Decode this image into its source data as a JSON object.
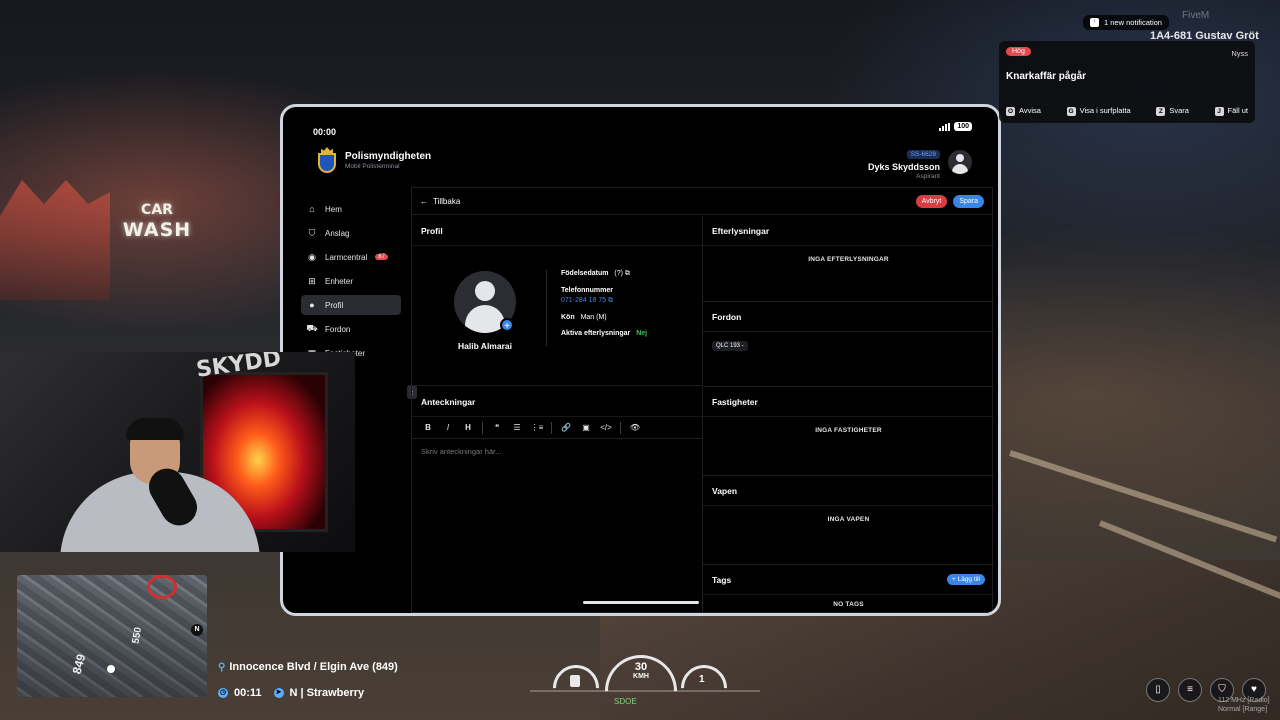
{
  "tablet": {
    "time": "00:00",
    "battery": "100",
    "brand_title": "Polismyndigheten",
    "brand_sub": "Mobil Polisterminal",
    "callsign": "SS-6628",
    "user_name": "Dyks Skyddsson",
    "user_rank": "Aspirant"
  },
  "sidebar": {
    "items": [
      {
        "label": "Hem",
        "icon": "home-icon"
      },
      {
        "label": "Anslag",
        "icon": "bookmark-icon"
      },
      {
        "label": "Larmcentral",
        "icon": "radio-icon",
        "badge": "87"
      },
      {
        "label": "Enheter",
        "icon": "grid-icon"
      },
      {
        "label": "Profil",
        "icon": "user-icon"
      },
      {
        "label": "Fordon",
        "icon": "car-icon"
      },
      {
        "label": "Fastigheter",
        "icon": "building-icon"
      }
    ]
  },
  "topbar": {
    "back_label": "Tillbaka",
    "cancel_label": "Avbryt",
    "save_label": "Spara"
  },
  "profile": {
    "title": "Profil",
    "name": "Halib Almarai",
    "birth_label": "Födelsedatum",
    "birth_value": "(?)",
    "phone_label": "Telefonnummer",
    "phone_value": "071-284 18 75",
    "gender_label": "Kön",
    "gender_value": "Man (M)",
    "warrants_label": "Aktiva efterlysningar",
    "warrants_value": "Nej"
  },
  "notes": {
    "title": "Anteckningar",
    "placeholder": "Skriv anteckningar här...",
    "toolbar": [
      "B",
      "I",
      "H",
      "❝",
      "☰",
      "⋮≡",
      "🔗",
      "▣",
      "</>",
      "👁"
    ]
  },
  "warrants": {
    "title": "Efterlysningar",
    "empty": "INGA EFTERLYSNINGAR"
  },
  "vehicles": {
    "title": "Fordon",
    "plate": "QLC 193 -"
  },
  "properties": {
    "title": "Fastigheter",
    "empty": "INGA FASTIGHETER"
  },
  "weapons": {
    "title": "Vapen",
    "empty": "INGA VAPEN"
  },
  "tags": {
    "title": "Tags",
    "add_label": "+ Lägg till",
    "empty": "NO TAGS"
  },
  "notification": {
    "pill": "1 new notification",
    "brand": "FiveM",
    "player": "1A4-681 Gustav Gröt",
    "priority": "Hög",
    "time": "Nyss",
    "title": "Knarkaffär pågår",
    "actions": [
      {
        "key": "O",
        "label": "Avvisa"
      },
      {
        "key": "G",
        "label": "Visa i surfplatta"
      },
      {
        "key": "Z",
        "label": "Svara"
      },
      {
        "key": "J",
        "label": "Fäll ut"
      }
    ]
  },
  "scene": {
    "carwash_l1": "CAR",
    "carwash_l2": "WASH",
    "webcam_text": "SKYDD"
  },
  "hud": {
    "street": "Innocence Blvd / Elgin Ave (849)",
    "time": "00:11",
    "direction": "N | Strawberry",
    "speed": "30",
    "speed_unit": "KMH",
    "gear": "1",
    "compass_text": "SDOE",
    "map_label1": "849",
    "map_label2": "550",
    "map_north": "N",
    "radio_line1": "112 MHz [Radio]",
    "radio_line2": "Normal [Range]"
  }
}
